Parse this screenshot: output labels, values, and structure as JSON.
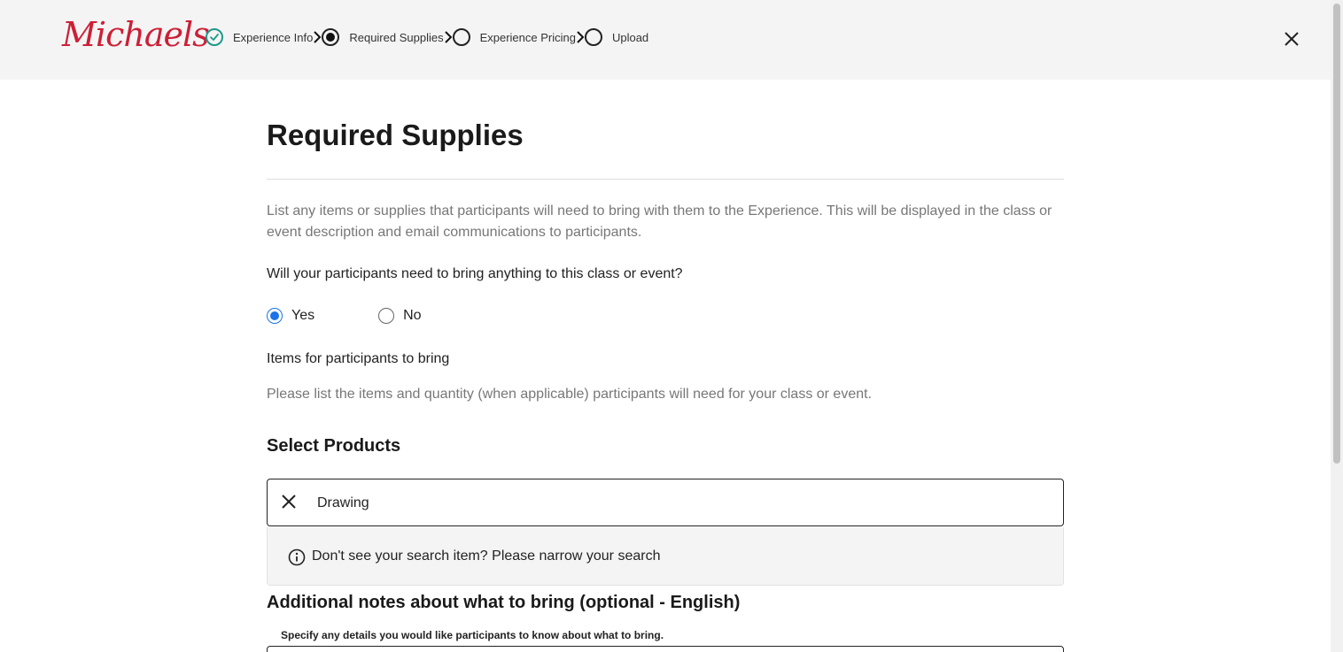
{
  "header": {
    "logo_text": "Michaels",
    "steps": [
      {
        "label": "Experience Info",
        "state": "completed"
      },
      {
        "label": "Required Supplies",
        "state": "current"
      },
      {
        "label": "Experience Pricing",
        "state": "upcoming"
      },
      {
        "label": "Upload",
        "state": "upcoming"
      }
    ],
    "close_icon": "close-icon"
  },
  "main": {
    "title": "Required Supplies",
    "description": "List any items or supplies that participants will need to bring with them to the Experience. This will be displayed in the class or event description and email communications to participants.",
    "question": "Will your participants need to bring anything to this class or event?",
    "options": [
      {
        "label": "Yes",
        "selected": true
      },
      {
        "label": "No",
        "selected": false
      }
    ],
    "items_label": "Items for participants to bring",
    "items_help": "Please list the items and quantity (when applicable) participants will need for your class or event.",
    "products_heading": "Select Products",
    "search": {
      "value": "Drawing",
      "no_result_message": "Don't see your search item? Please narrow your search"
    },
    "notes_heading": "Additional notes about what to bring (optional - English)",
    "notes_help": "Specify any details you would like participants to know about what to bring."
  },
  "colors": {
    "brand": "#cc1f36",
    "completed": "#1d9a8a",
    "radio_selected": "#1a73e8",
    "header_bg": "#f4f4f4"
  }
}
